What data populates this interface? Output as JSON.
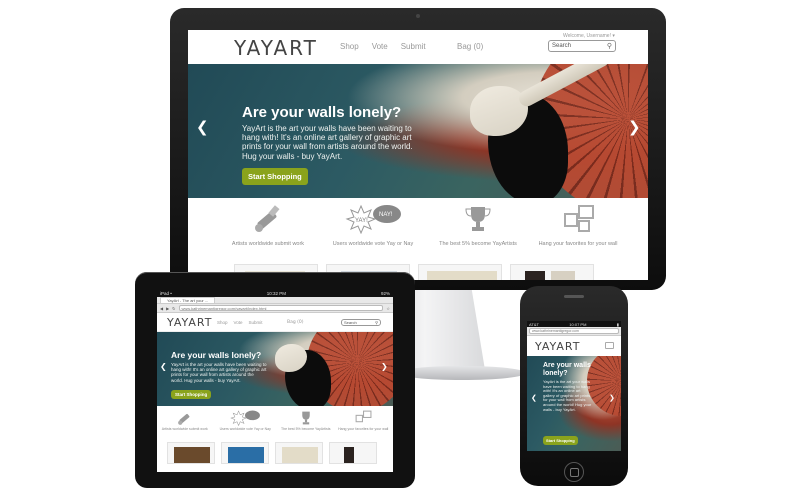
{
  "site": {
    "logo": "YAYART",
    "nav": [
      "Shop",
      "Vote",
      "Submit"
    ],
    "bag": "Bag (0)",
    "welcome": "Welcome, Username! ▾",
    "search_placeholder": "Search",
    "hero": {
      "title": "Are your walls lonely?",
      "text": "YayArt is the art your walls have been waiting to hang with! It's an online art gallery of graphic art prints for your wall from artists around the world. Hug your walls - buy YayArt.",
      "cta": "Start Shopping"
    },
    "features": [
      {
        "label": "Artists worldwide submit work",
        "icon": "paintbrush-icon"
      },
      {
        "label": "Users worldwide vote Yay or Nay",
        "icon": "yay-nay-burst-icon",
        "yay": "YAY!",
        "nay": "NAY!"
      },
      {
        "label": "The best 5% become YayArtists",
        "icon": "trophy-icon"
      },
      {
        "label": "Hang your favorites for your wall",
        "icon": "frames-icon"
      }
    ]
  },
  "tablet": {
    "status_left": "iPad •",
    "status_time": "10:32 PM",
    "status_right": "92%",
    "tab_title": "YayArt - The art your ...",
    "url": "www.kathrinemantigregor.com/yayart/index.html",
    "features": [
      "Artists worldwide submit work",
      "Users worldwide vote Yay or Nay",
      "The best 5% become YayArtists",
      "Hang your favorites for your wall"
    ]
  },
  "phone": {
    "carrier": "AT&T",
    "time": "10:07 PM",
    "url": "www.kathrinemantigregor.com",
    "hero_title": "Are your walls lonely?",
    "hero_text": "YayArt is the art your walls have been waiting to hang with! It's an online art gallery of graphic art prints for your wall from artists around the world! Hug your walls - buy YayArt.",
    "cta": "Start Shopping"
  },
  "colors": {
    "accent_green": "#8aa31c",
    "hero_teal": "#2c5a63",
    "umbrella_red": "#b24a34",
    "device_black": "#111111"
  },
  "icons": {
    "prev": "chevron-left-icon",
    "next": "chevron-right-icon",
    "search": "magnifier-icon"
  }
}
